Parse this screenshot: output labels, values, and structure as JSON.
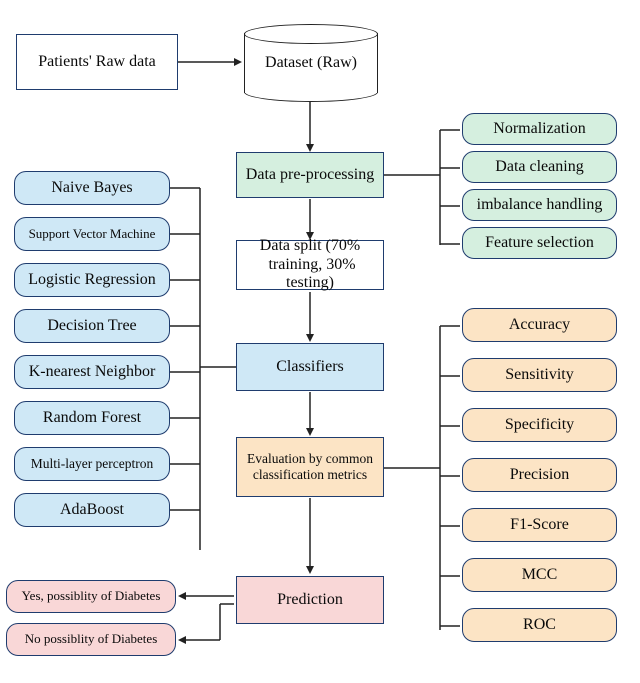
{
  "input_box": "Patients' Raw data",
  "dataset": "Dataset (Raw)",
  "preprocessing": "Data pre-processing",
  "split": "Data split (70%  training, 30% testing)",
  "classifiers_box": "Classifiers",
  "evaluation_box": "Evaluation by common classification metrics",
  "prediction_box": "Prediction",
  "prep_steps": [
    "Normalization",
    "Data cleaning",
    "imbalance handling",
    "Feature selection"
  ],
  "classifiers": [
    "Naive Bayes",
    "Support Vector Machine",
    "Logistic Regression",
    "Decision Tree",
    "K-nearest Neighbor",
    "Random Forest",
    "Multi-layer perceptron",
    "AdaBoost"
  ],
  "metrics": [
    "Accuracy",
    "Sensitivity",
    "Specificity",
    "Precision",
    "F1-Score",
    "MCC",
    "ROC"
  ],
  "outcomes": [
    "Yes, possiblity of Diabetes",
    "No possiblity of Diabetes"
  ]
}
